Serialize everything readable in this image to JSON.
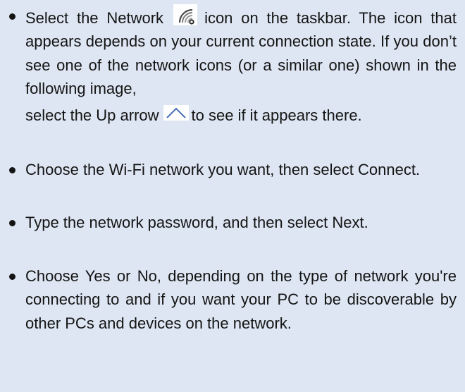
{
  "content": {
    "items": [
      {
        "text_before_icon": "Select the Network",
        "text_after_icon": "icon on the taskbar. The icon that appears depends on your current connection state. If you don’t see one of the network icons (or a similar one) shown in the following image,",
        "text_before_arrow": "select the Up arrow",
        "text_after_arrow": "to see if it appears there."
      },
      {
        "text": "Choose the Wi-Fi network you want, then select Connect."
      },
      {
        "text": "Type the network password, and then select Next."
      },
      {
        "text": "Choose Yes or No, depending on the type of network you're connecting to and if you want your PC to be discoverable by other PCs and devices on the network."
      }
    ],
    "icons": {
      "network": "wifi-network-icon",
      "up_arrow": "up-arrow-icon"
    }
  },
  "colors": {
    "background": "#dde6f2",
    "text": "#141414",
    "icon_tile": "#ffffff",
    "icon_bars": "#4a4a4a",
    "arrow_stroke": "#4a6fb0"
  }
}
